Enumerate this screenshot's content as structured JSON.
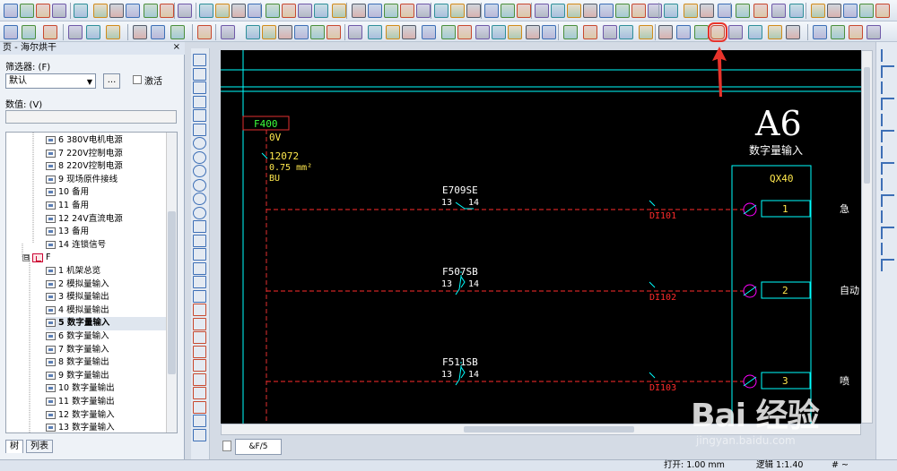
{
  "left_panel": {
    "title": "页 - 海尔烘干",
    "close_label": "×",
    "filter_label": "筛选器: (F)",
    "filter_value": "默认",
    "ellipsis_label": "...",
    "activate_label": "激活",
    "value_label": "数值: (V)",
    "value_text": "",
    "tree_items": [
      {
        "label": "6 380V电机电源",
        "level": 3
      },
      {
        "label": "7 220V控制电源",
        "level": 3
      },
      {
        "label": "8 220V控制电源",
        "level": 3
      },
      {
        "label": "9 现场原件接线",
        "level": 3
      },
      {
        "label": "10 备用",
        "level": 3
      },
      {
        "label": "11 备用",
        "level": 3
      },
      {
        "label": "12 24V直流电源",
        "level": 3
      },
      {
        "label": "13 备用",
        "level": 3
      },
      {
        "label": "14 连锁信号",
        "level": 3
      },
      {
        "label": "F",
        "level": 2,
        "expander": "⊟"
      },
      {
        "label": "1 机架总览",
        "level": 3
      },
      {
        "label": "2 模拟量输入",
        "level": 3
      },
      {
        "label": "3 模拟量输出",
        "level": 3
      },
      {
        "label": "4 模拟量输出",
        "level": 3
      },
      {
        "label": "5 数字量输入",
        "level": 3,
        "selected": true
      },
      {
        "label": "6 数字量输入",
        "level": 3
      },
      {
        "label": "7 数字量输入",
        "level": 3
      },
      {
        "label": "8 数字量输出",
        "level": 3
      },
      {
        "label": "9 数字量输出",
        "level": 3
      },
      {
        "label": "10 数字量输出",
        "level": 3
      },
      {
        "label": "11 数字量输出",
        "level": 3
      },
      {
        "label": "12 数字量输入",
        "level": 3
      },
      {
        "label": "13 数字量输入",
        "level": 3
      }
    ],
    "tabs": [
      "树",
      "列表"
    ]
  },
  "drawing": {
    "frame_label": "F400",
    "voltage": "0V",
    "wire_number": "12072",
    "wire_section": "0.75 mm²",
    "wire_color": "BU",
    "module_title": "A6",
    "module_subtitle": "数字量输入",
    "module_name": "QX40",
    "rows": [
      {
        "device": "E709SE",
        "pin_a": "13",
        "pin_b": "14",
        "signal": "DI101",
        "terminal": "1",
        "right_text": "急"
      },
      {
        "device": "F507SB",
        "pin_a": "13",
        "pin_b": "14",
        "signal": "DI102",
        "terminal": "2",
        "right_text": "自动"
      },
      {
        "device": "F511SB",
        "pin_a": "13",
        "pin_b": "14",
        "signal": "DI103",
        "terminal": "3",
        "right_text": "喷"
      }
    ],
    "colors": {
      "background": "#000000",
      "cyan": "#00ffff",
      "red_wire": "#ff2b2b",
      "text_yellow": "#ffe84d",
      "frame_red": "#e23030",
      "highlight": "#ff00ff"
    }
  },
  "page_tab": "&F/5",
  "status": {
    "open": "打开: 1.00 mm",
    "logic": "逻辑 1:1.40",
    "hash": "# ~"
  },
  "watermark": {
    "main": "Bai 经验",
    "sub": "jingyan.baidu.com"
  }
}
